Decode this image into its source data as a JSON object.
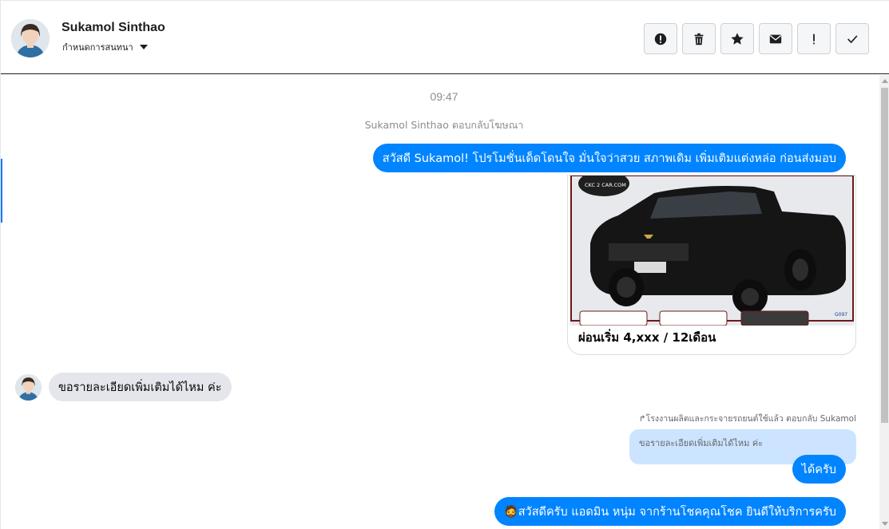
{
  "header": {
    "contact_name": "Sukamol Sinthao",
    "assign_label": "กำหนดการสนทนา",
    "avatar_icon": "user-avatar",
    "actions": [
      {
        "name": "mark-spam",
        "icon": "exclamation-circle-icon"
      },
      {
        "name": "delete",
        "icon": "trash-icon"
      },
      {
        "name": "star",
        "icon": "star-icon"
      },
      {
        "name": "mark-unread",
        "icon": "envelope-icon"
      },
      {
        "name": "follow-up",
        "icon": "exclamation-icon"
      },
      {
        "name": "mark-done",
        "icon": "check-icon"
      }
    ]
  },
  "conversation": {
    "timestamp": "09:47",
    "reply_note": "Sukamol Sinthao ตอบกลับโฆษณา",
    "messages": [
      {
        "direction": "out",
        "text": "สวัสดี Sukamol! โปรโมชั่นเด็ดโดนใจ มั่นใจว่าสวย สภาพเดิม เพิ่มเติมแต่งหล่อ ก่อนส่งมอบ"
      },
      {
        "direction": "out",
        "type": "ad-card",
        "image_watermark": "CKC 2 CAR.COM",
        "image_badge": "G097",
        "caption": "ผ่อนเริ่ม 4,xxx / 12เดือน"
      },
      {
        "direction": "in",
        "text": "ขอรายละเอียดเพิ่มเติมได้ไหม ค่ะ"
      },
      {
        "direction": "out",
        "forward_note": "โรงงานผลิตและกระจายรถยนต์ใช้แล้ว ตอบกลับ Sukamol",
        "quoted_text": "ขอรายละเอียดเพิ่มเติมได้ไหม ค่ะ",
        "text": "ได้ครับ"
      },
      {
        "direction": "out",
        "emoji": "🧔",
        "text": "สวัสดีครับ แอดมิน หนุ่ม จากร้านโชคคุณโชค ยินดีให้บริการครับ"
      }
    ]
  },
  "colors": {
    "accent": "#0084ff",
    "incoming_bubble": "#e4e6eb",
    "quoted_bubble": "#cce4ff"
  }
}
